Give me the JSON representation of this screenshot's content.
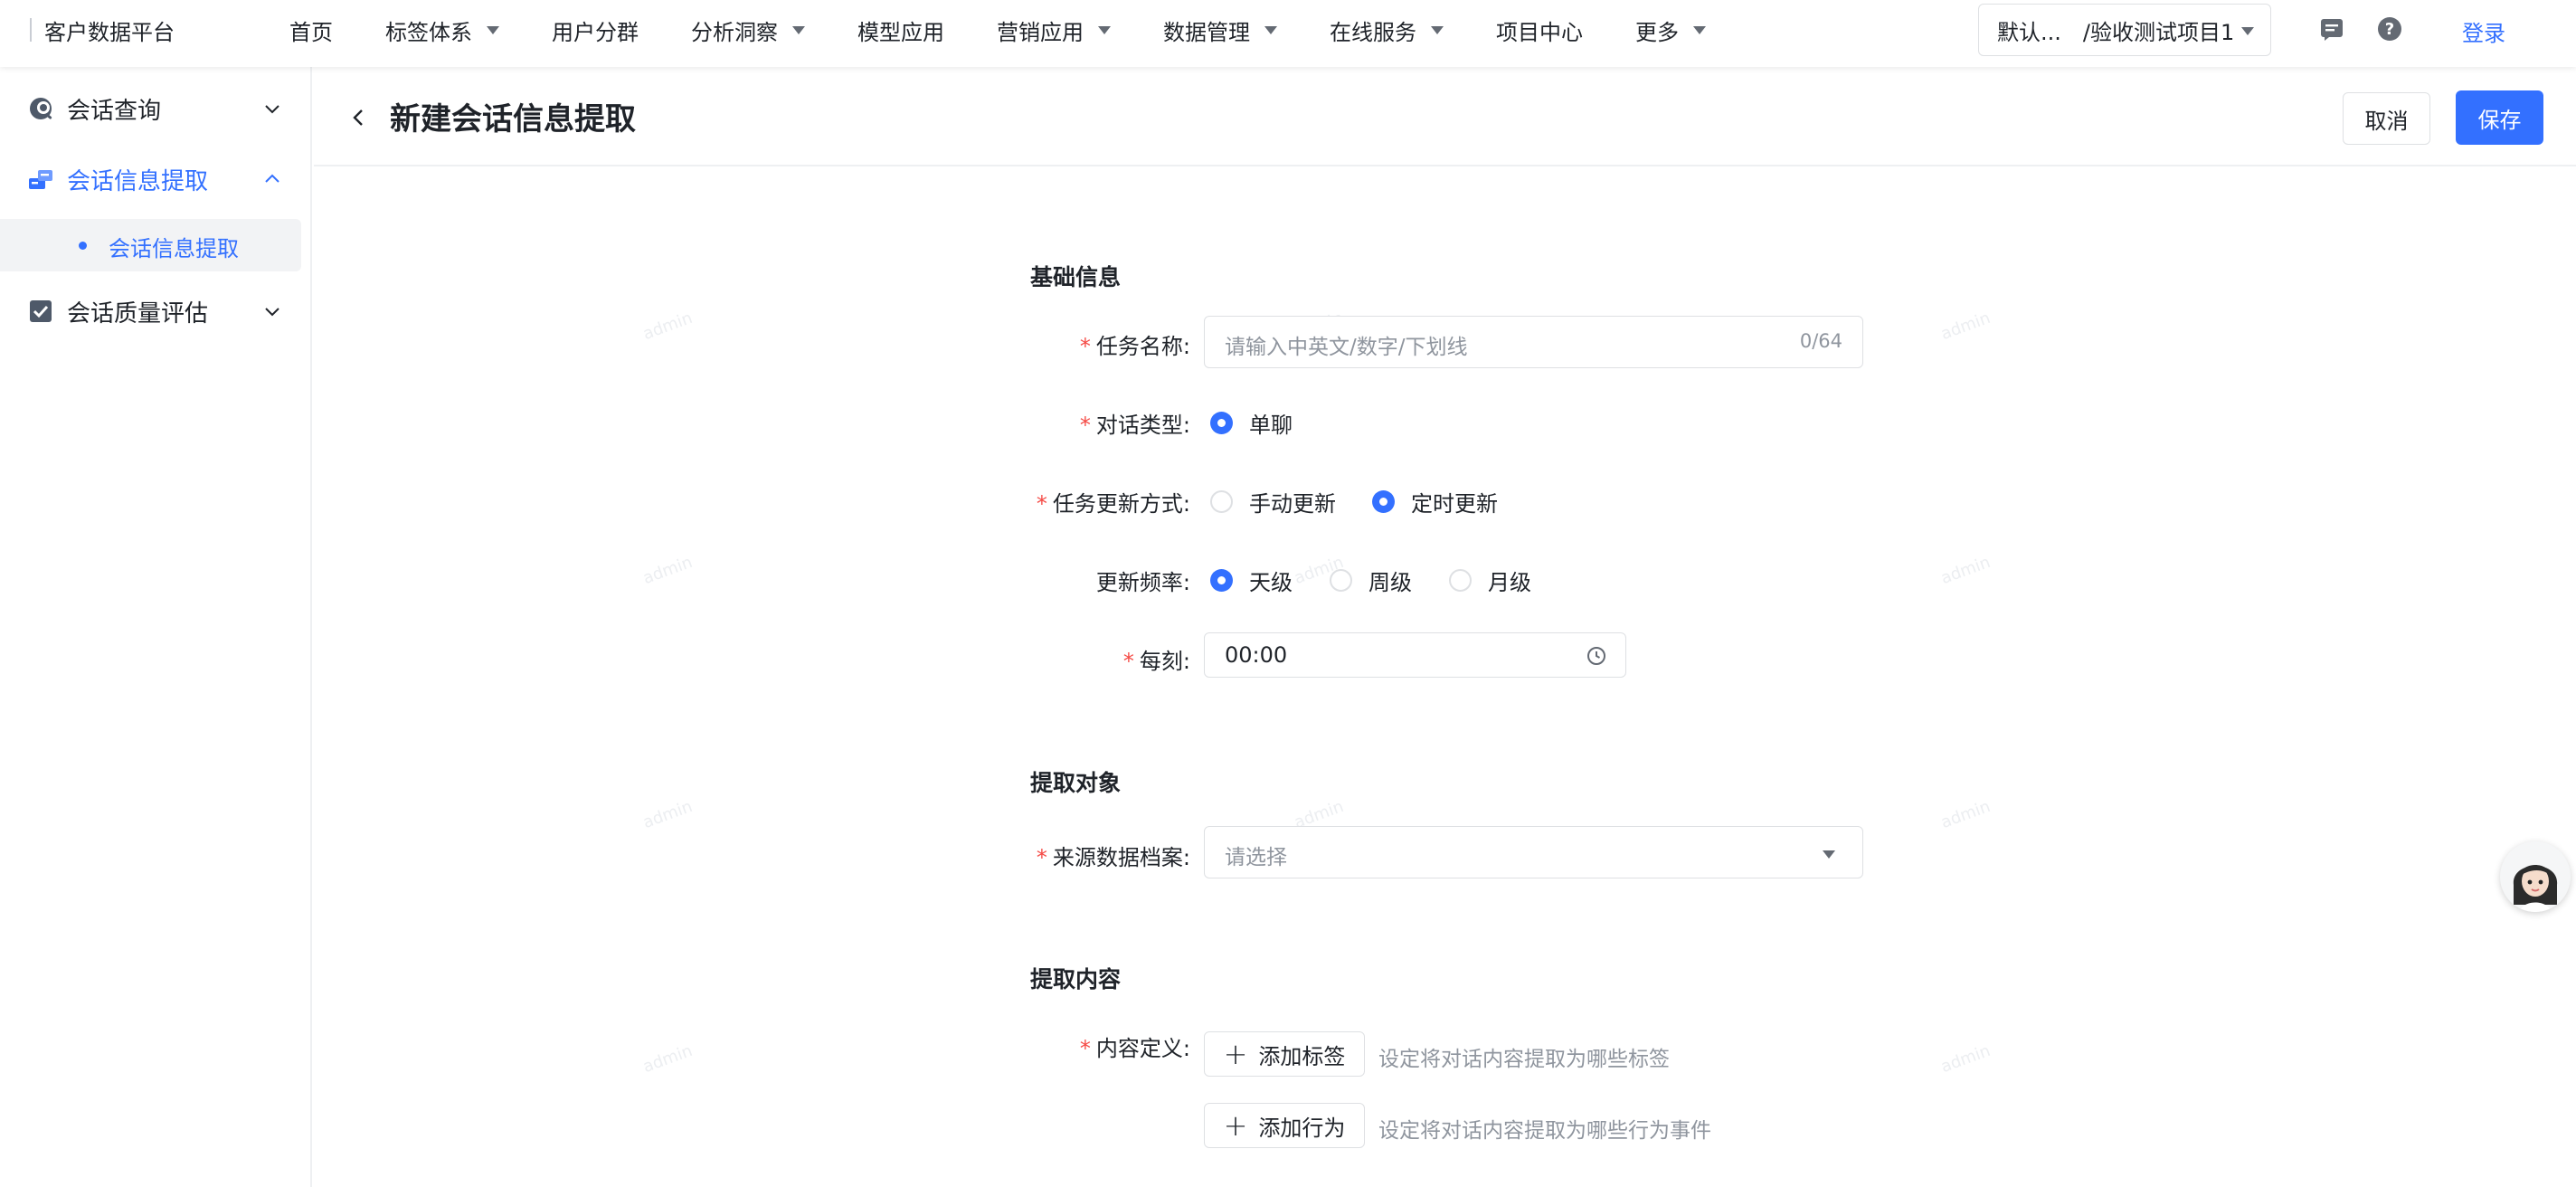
{
  "app": {
    "title": "客户数据平台"
  },
  "nav": {
    "items": [
      {
        "label": "首页",
        "has_dropdown": false
      },
      {
        "label": "标签体系",
        "has_dropdown": true
      },
      {
        "label": "用户分群",
        "has_dropdown": false
      },
      {
        "label": "分析洞察",
        "has_dropdown": true
      },
      {
        "label": "模型应用",
        "has_dropdown": false
      },
      {
        "label": "营销应用",
        "has_dropdown": true
      },
      {
        "label": "数据管理",
        "has_dropdown": true
      },
      {
        "label": "在线服务",
        "has_dropdown": true
      },
      {
        "label": "项目中心",
        "has_dropdown": false
      },
      {
        "label": "更多",
        "has_dropdown": true
      }
    ]
  },
  "project_selector": {
    "value": "默认...　/验收测试项目1"
  },
  "header_icons": [
    "message-icon",
    "help-icon"
  ],
  "login_label": "登录",
  "sidebar": {
    "items": [
      {
        "label": "会话查询",
        "icon": "session-query-icon",
        "expanded": false
      },
      {
        "label": "会话信息提取",
        "icon": "info-extract-icon",
        "expanded": true,
        "active": true
      },
      {
        "label": "会话质量评估",
        "icon": "quality-check-icon",
        "expanded": false
      }
    ],
    "sub_item": {
      "label": "会话信息提取",
      "active": true
    }
  },
  "page": {
    "title": "新建会话信息提取",
    "cancel_label": "取消",
    "save_label": "保存"
  },
  "form": {
    "basic": {
      "title": "基础信息",
      "task_name": {
        "label": "任务名称:",
        "placeholder": "请输入中英文/数字/下划线",
        "counter": "0/64",
        "required": true
      },
      "dialog_type": {
        "label": "对话类型:",
        "options": [
          "单聊"
        ],
        "selected": "单聊",
        "required": true
      },
      "update_mode": {
        "label": "任务更新方式:",
        "options": [
          "手动更新",
          "定时更新"
        ],
        "selected": "定时更新",
        "required": true
      },
      "frequency": {
        "label": "更新频率:",
        "options": [
          "天级",
          "周级",
          "月级"
        ],
        "selected": "天级",
        "required": false
      },
      "every_time": {
        "label": "每刻:",
        "value": "00:00",
        "required": true
      }
    },
    "target": {
      "title": "提取对象",
      "source": {
        "label": "来源数据档案:",
        "placeholder": "请选择",
        "required": true
      }
    },
    "content": {
      "title": "提取内容",
      "definition": {
        "label": "内容定义:",
        "required": true
      },
      "add_tag": {
        "label": "添加标签",
        "hint": "设定将对话内容提取为哪些标签"
      },
      "add_action": {
        "label": "添加行为",
        "hint": "设定将对话内容提取为哪些行为事件"
      }
    }
  },
  "watermark": "admin",
  "colors": {
    "primary": "#3370ff",
    "required": "#f54a45",
    "text": "#1f2329",
    "muted": "#8f959e"
  }
}
